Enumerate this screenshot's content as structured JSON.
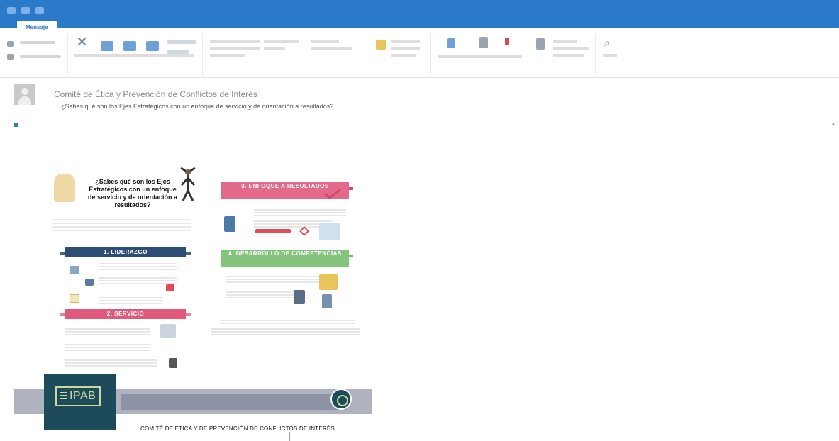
{
  "window": {
    "title": "",
    "tabs": [
      "",
      "",
      " "
    ],
    "active_tab": "Mensaje"
  },
  "ribbon": {
    "groups": [
      {
        "label": ""
      },
      {
        "label": ""
      },
      {
        "label": ""
      },
      {
        "label": ""
      },
      {
        "label": ""
      },
      {
        "label": ""
      },
      {
        "label": ""
      }
    ]
  },
  "message": {
    "sender": "",
    "subject": "Comité de Ética y Prevención de Conflictos de Interés",
    "preview": "¿Sabes qué son los Ejes Estratégicos con un enfoque de servicio y de orientación a resultados?",
    "to_line": "",
    "sent_line": ""
  },
  "infographic": {
    "question": "¿Sabes qué son los Ejes Estratégicos con un enfoque de servicio y de orientación a resultados?",
    "section1": "1. LIDERAZGO",
    "section2": "2. SERVICIO",
    "section3": "3. ENFOQUE A RESULTADOS",
    "section4": "4. DESARROLLO DE COMPETENCIAS"
  },
  "footer": {
    "logo_text": "IPAB",
    "title": "COMITÉ DE ÉTICA Y DE PREVENCIÓN DE CONFLICTOS DE INTERÉS"
  },
  "colors": {
    "titlebar": "#2b79c9",
    "navy": "#2d4d74",
    "pink": "#e0587a",
    "rose": "#e36a8a",
    "green": "#84c47d",
    "logo": "#1d4b59"
  }
}
